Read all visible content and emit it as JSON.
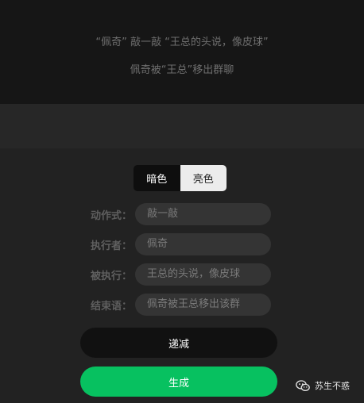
{
  "preview": {
    "line1": "“佩奇” 敲一敲 “王总的头说，像皮球”",
    "line2": "佩奇被“王总”移出群聊"
  },
  "theme_toggle": {
    "dark_label": "暗色",
    "light_label": "亮色",
    "selected": "暗色"
  },
  "form": {
    "action": {
      "label": "动作式：",
      "value": "敲一敲"
    },
    "performer": {
      "label": "执行者：",
      "value": "佩奇"
    },
    "target": {
      "label": "被执行：",
      "value": "王总的头说，像皮球"
    },
    "ending": {
      "label": "结束语：",
      "value": "佩奇被王总移出该群"
    }
  },
  "buttons": {
    "decrement": "递减",
    "generate": "生成"
  },
  "watermark": {
    "text": "苏生不惑",
    "icon": "wechat-icon"
  },
  "colors": {
    "accent_green": "#07c160",
    "background": "#272727",
    "preview_bg": "#161616"
  }
}
